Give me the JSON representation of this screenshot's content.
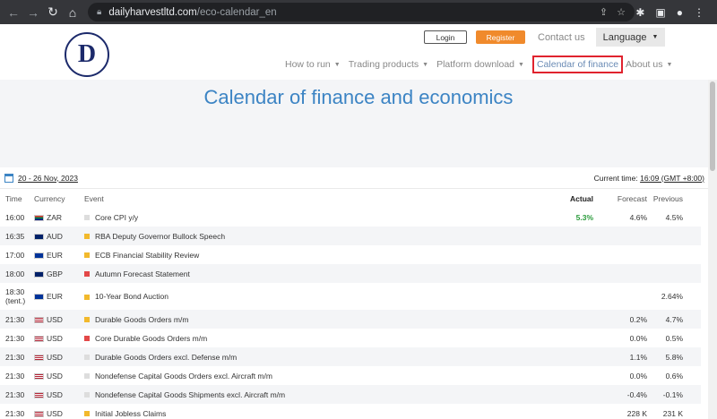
{
  "browser": {
    "url_host": "dailyharvestltd.com",
    "url_path": "/eco-calendar_en"
  },
  "header": {
    "login_label": "Login",
    "register_label": "Register",
    "contact_label": "Contact us",
    "language_label": "Language",
    "nav": [
      {
        "label": "How to run",
        "dropdown": true
      },
      {
        "label": "Trading products",
        "dropdown": true
      },
      {
        "label": "Platform download",
        "dropdown": true
      },
      {
        "label": "Calendar of finance",
        "dropdown": false,
        "current": true
      },
      {
        "label": "About us",
        "dropdown": true
      }
    ]
  },
  "banner": {
    "title": "Calendar of finance and economics"
  },
  "calendar": {
    "date_range": "20 - 26 Nov, 2023",
    "current_time_label": "Current time:",
    "current_time_value": "16:09 (GMT +8:00)",
    "columns": [
      "Time",
      "Currency",
      "Event",
      "Actual",
      "Forecast",
      "Previous"
    ],
    "rows": [
      {
        "time": "16:00",
        "currency": "ZAR",
        "event": "Core CPI y/y",
        "importance": "low",
        "actual": "5.3%",
        "forecast": "4.6%",
        "previous": "4.5%"
      },
      {
        "time": "16:35",
        "currency": "AUD",
        "event": "RBA Deputy Governor Bullock Speech",
        "importance": "mid",
        "actual": "",
        "forecast": "",
        "previous": ""
      },
      {
        "time": "17:00",
        "currency": "EUR",
        "event": "ECB Financial Stability Review",
        "importance": "mid",
        "actual": "",
        "forecast": "",
        "previous": ""
      },
      {
        "time": "18:00",
        "currency": "GBP",
        "event": "Autumn Forecast Statement",
        "importance": "high",
        "actual": "",
        "forecast": "",
        "previous": ""
      },
      {
        "time": "18:30 (tent.)",
        "currency": "EUR",
        "event": "10-Year Bond Auction",
        "importance": "mid",
        "actual": "",
        "forecast": "",
        "previous": "2.64%"
      },
      {
        "time": "21:30",
        "currency": "USD",
        "event": "Durable Goods Orders m/m",
        "importance": "mid",
        "actual": "",
        "forecast": "0.2%",
        "previous": "4.7%"
      },
      {
        "time": "21:30",
        "currency": "USD",
        "event": "Core Durable Goods Orders m/m",
        "importance": "high",
        "actual": "",
        "forecast": "0.0%",
        "previous": "0.5%"
      },
      {
        "time": "21:30",
        "currency": "USD",
        "event": "Durable Goods Orders excl. Defense m/m",
        "importance": "low",
        "actual": "",
        "forecast": "1.1%",
        "previous": "5.8%"
      },
      {
        "time": "21:30",
        "currency": "USD",
        "event": "Nondefense Capital Goods Orders excl. Aircraft m/m",
        "importance": "low",
        "actual": "",
        "forecast": "0.0%",
        "previous": "0.6%"
      },
      {
        "time": "21:30",
        "currency": "USD",
        "event": "Nondefense Capital Goods Shipments excl. Aircraft m/m",
        "importance": "low",
        "actual": "",
        "forecast": "-0.4%",
        "previous": "-0.1%"
      },
      {
        "time": "21:30",
        "currency": "USD",
        "event": "Initial Jobless Claims",
        "importance": "mid",
        "actual": "",
        "forecast": "228 K",
        "previous": "231 K"
      }
    ]
  }
}
